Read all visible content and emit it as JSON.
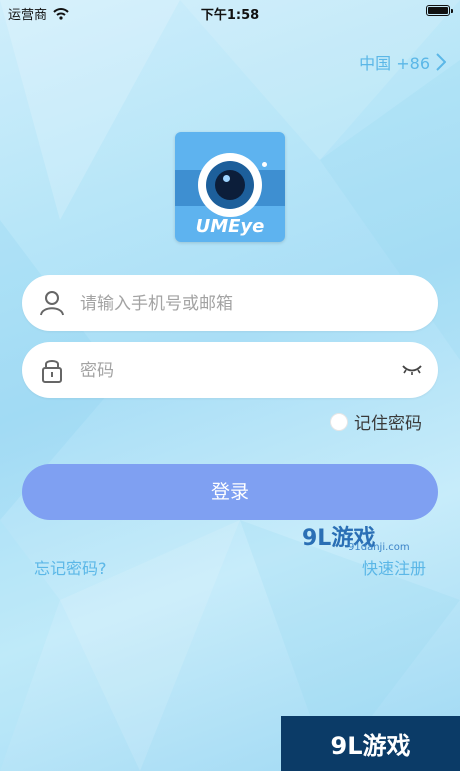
{
  "status_bar": {
    "carrier": "运营商",
    "time": "下午1:58"
  },
  "region": {
    "label": "中国 +86"
  },
  "logo": {
    "name": "UMEye"
  },
  "form": {
    "account_placeholder": "请输入手机号或邮箱",
    "password_placeholder": "密码",
    "remember_label": "记住密码",
    "login_label": "登录"
  },
  "links": {
    "forgot": "忘记密码?",
    "register": "快速注册"
  },
  "watermark": {
    "brand": "9L游戏",
    "site": "91danji.com"
  },
  "colors": {
    "accent": "#5bb7e7",
    "login_button": "#7fa0f2",
    "background": "#b8e6f8"
  }
}
